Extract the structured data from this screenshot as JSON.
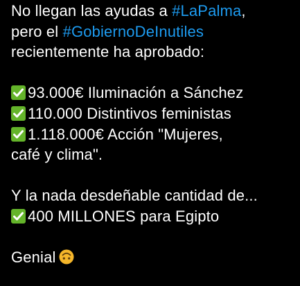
{
  "post": {
    "intro": {
      "line1_text": "No llegan las ayudas a ",
      "hashtag1": "#LaPalma",
      "line1_end": ",",
      "line2_text": "pero el ",
      "hashtag2": "#GobiernoDeInutiles",
      "line3": "recientemente ha aprobado:"
    },
    "items": [
      {
        "text": "93.000€ Iluminación a Sánchez"
      },
      {
        "text": "110.000 Distintivos feministas"
      },
      {
        "text": "1.118.000€ Acción \"Mujeres,"
      }
    ],
    "item3_continuation": "café y clima\".",
    "closing_intro": "Y la nada desdeñable cantidad de...",
    "closing_item": "400 MILLONES para Egipto",
    "signoff": "Genial",
    "icons": {
      "check": "check-mark-button-icon",
      "signoff_emoji": "upside-down-face-emoji"
    },
    "colors": {
      "background": "#000000",
      "text": "#ffffff",
      "hashtag": "#1d9bf0",
      "check": "#64b42a",
      "emoji": "#f5b62a"
    }
  }
}
